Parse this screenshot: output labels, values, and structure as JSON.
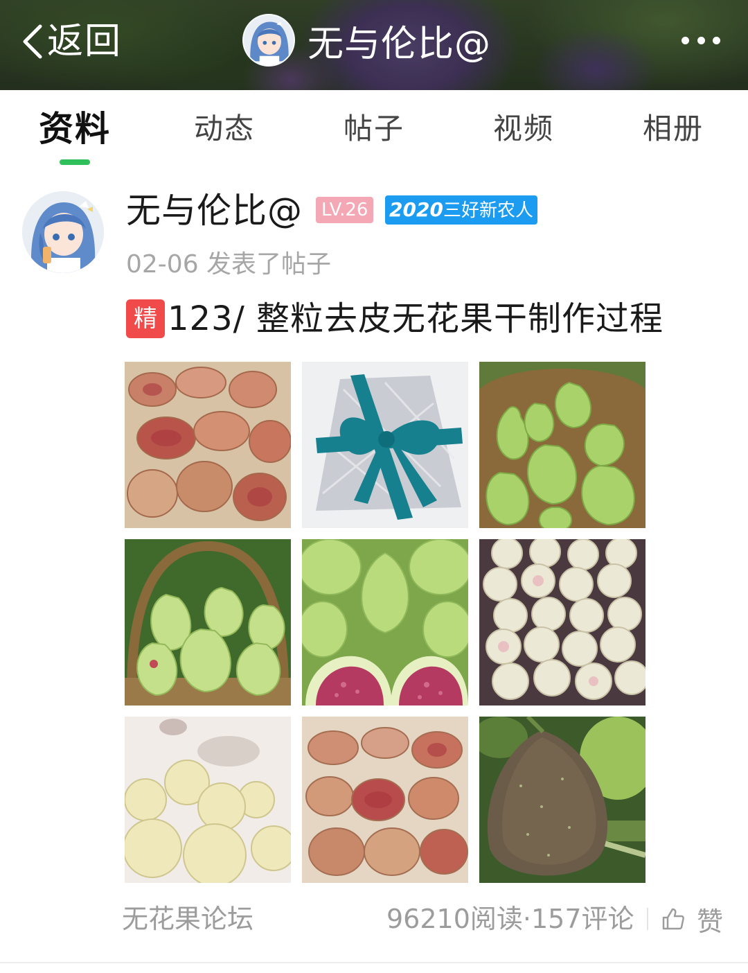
{
  "header": {
    "back_label": "返回",
    "title": "无与伦比@",
    "back_icon": "chevron-left-icon",
    "more_icon": "more-dots-icon"
  },
  "tabs": [
    {
      "label": "资料",
      "active": true
    },
    {
      "label": "动态",
      "active": false
    },
    {
      "label": "帖子",
      "active": false
    },
    {
      "label": "视频",
      "active": false
    },
    {
      "label": "相册",
      "active": false
    }
  ],
  "post": {
    "author": "无与伦比@",
    "level_badge": "LV.26",
    "honor_year": "2020",
    "honor_text": "三好新农人",
    "meta": "02-06 发表了帖子",
    "featured_badge": "精",
    "title": "123/ 整粒去皮无花果干制作过程",
    "images": [
      "dried-figs-slices",
      "gift-wrapped-package",
      "green-figs-basket",
      "green-figs-basket-2",
      "halved-green-figs",
      "peeled-figs-pile",
      "peeled-white-figs",
      "dried-figs-slices-2",
      "purple-fig-on-tree"
    ]
  },
  "footer": {
    "forum": "无花果论坛",
    "stats": "96210阅读·157评论",
    "like_label": "赞",
    "like_icon": "thumbs-up-icon"
  },
  "colors": {
    "tab_indicator": "#2fbf5b",
    "level_badge": "#f4a7b5",
    "honor_badge": "#1c9cf0",
    "featured_badge": "#f04a4a",
    "muted_text": "#9c9c9c"
  }
}
